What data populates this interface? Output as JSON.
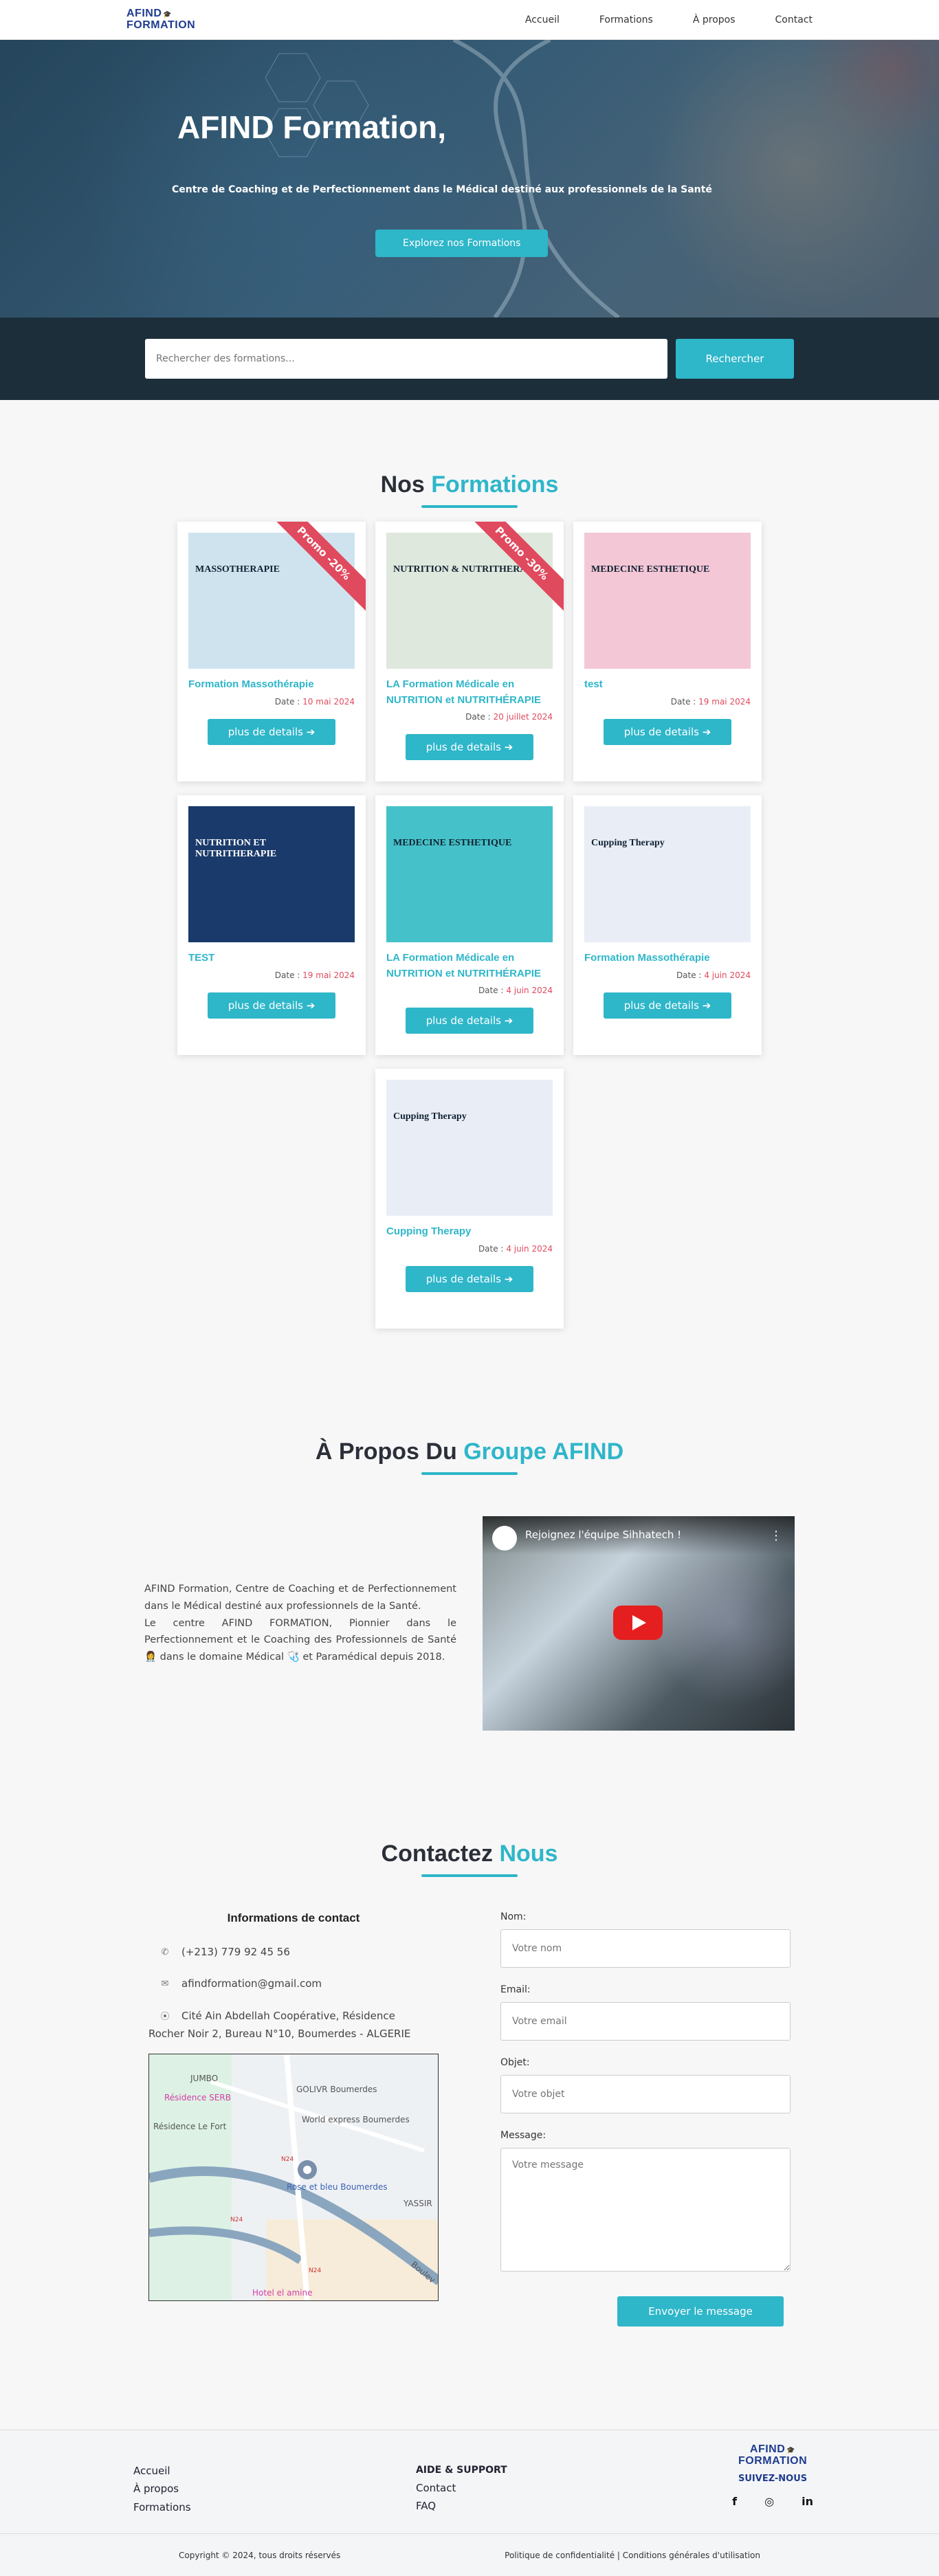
{
  "brand": {
    "line1": "AFIND",
    "line2": "FORMATION"
  },
  "nav": [
    "Accueil",
    "Formations",
    "À propos",
    "Contact"
  ],
  "hero": {
    "title": "AFIND Formation,",
    "subtitle": "Centre de Coaching et de Perfectionnement dans le Médical destiné aux professionnels de la Santé",
    "cta": "Explorez nos Formations"
  },
  "search": {
    "placeholder": "Rechercher des formations...",
    "button": "Rechercher"
  },
  "formations": {
    "title_a": "Nos",
    "title_b": "Formations",
    "date_label": "Date :",
    "button": "plus de details ➔",
    "cards": [
      {
        "title": "Formation Massothérapie",
        "date": "10 mai 2024",
        "promo": "Promo -20%",
        "thumb_color": "#cfe3ef",
        "thumb_text": "MASSOTHERAPIE"
      },
      {
        "title": "LA Formation Médicale en NUTRITION et NUTRITHÉRAPIE",
        "date": "20 juillet 2024",
        "promo": "Promo -30%",
        "thumb_color": "#dfe8dc",
        "thumb_text": "NUTRITION & NUTRITHERAPIE"
      },
      {
        "title": "test",
        "date": "19 mai 2024",
        "promo": "",
        "thumb_color": "#f4c7d6",
        "thumb_text": "MEDECINE ESTHETIQUE"
      },
      {
        "title": "TEST",
        "date": "19 mai 2024",
        "promo": "",
        "thumb_color": "#1a3a6b",
        "thumb_text": "NUTRITION ET NUTRITHERAPIE"
      },
      {
        "title": "LA Formation Médicale en NUTRITION et NUTRITHÉRAPIE",
        "date": "4 juin 2024",
        "promo": "",
        "thumb_color": "#45c2c9",
        "thumb_text": "MEDECINE ESTHETIQUE"
      },
      {
        "title": "Formation Massothérapie",
        "date": "4 juin 2024",
        "promo": "",
        "thumb_color": "#e9eef6",
        "thumb_text": "Cupping Therapy"
      },
      {
        "title": "Cupping Therapy",
        "date": "4 juin 2024",
        "promo": "",
        "thumb_color": "#e9eef6",
        "thumb_text": "Cupping Therapy"
      }
    ]
  },
  "about": {
    "title_a": "À Propos Du",
    "title_b": "Groupe AFIND",
    "p1": "AFIND Formation, Centre de Coaching et de Perfectionnement dans le Médical destiné aux professionnels de la Santé.",
    "p2": "Le centre AFIND FORMATION, Pionnier dans le Perfectionnement et le Coaching des Professionnels de Santé 👩‍⚕️ dans le domaine Médical 🩺 et Paramédical depuis 2018.",
    "video_title": "Rejoignez l'équipe Sihhatech !"
  },
  "contact": {
    "title_a": "Contactez",
    "title_b": "Nous",
    "info_title": "Informations de contact",
    "phone": "(+213) 779 92 45 56",
    "email": "afindformation@gmail.com",
    "address1": "Cité Ain Abdellah Coopérative, Résidence",
    "address2": "Rocher Noir 2, Bureau N°10, Boumerdes - ALGERIE",
    "map_labels": [
      "JUMBO",
      "Résidence SERB",
      "GOLIVR Boumerdes",
      "Résidence Le Fort",
      "World express Boumerdes",
      "Rose et bleu Boumerdes",
      "YASSIR",
      "Hotel el amine",
      "N24",
      "N24",
      "N24",
      "Boulev"
    ],
    "form": {
      "name_label": "Nom:",
      "name_ph": "Votre nom",
      "email_label": "Email:",
      "email_ph": "Votre email",
      "subject_label": "Objet:",
      "subject_ph": "Votre objet",
      "message_label": "Message:",
      "message_ph": "Votre message",
      "submit": "Envoyer le message"
    }
  },
  "footer": {
    "links": [
      "Accueil",
      "À propos",
      "Formations"
    ],
    "support_head": "AIDE & SUPPORT",
    "support": [
      "Contact",
      "FAQ"
    ],
    "follow": "SUIVEZ-NOUS",
    "social": [
      "f",
      "◎",
      "in"
    ],
    "copyright": "Copyright © 2024, tous droits réservés",
    "legal": "Politique de confidentialité | Conditions générales d'utilisation"
  }
}
